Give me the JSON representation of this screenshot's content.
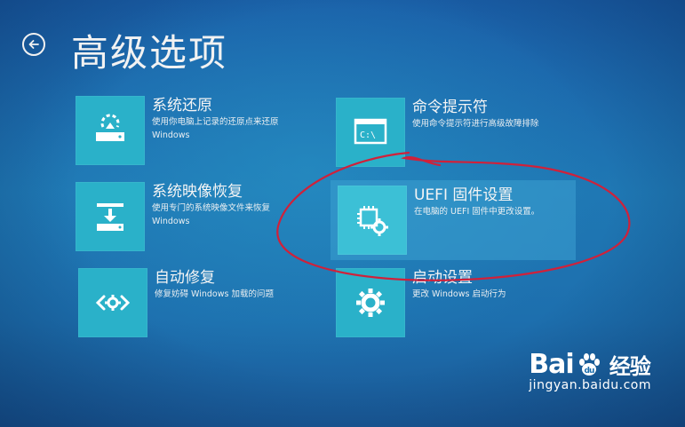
{
  "header": {
    "title": "高级选项",
    "back_icon": "back-arrow-icon"
  },
  "tiles": [
    {
      "id": "system-restore",
      "title": "系统还原",
      "desc_line1": "使用你电脑上记录的还原点来还原",
      "desc_line2": "Windows",
      "icon": "restore-icon"
    },
    {
      "id": "system-image-recovery",
      "title": "系统映像恢复",
      "desc_line1": "使用专门的系统映像文件来恢复",
      "desc_line2": "Windows",
      "icon": "image-recovery-icon"
    },
    {
      "id": "startup-repair",
      "title": "自动修复",
      "desc_line1": "修复妨碍 Windows 加载的问题",
      "desc_line2": "",
      "icon": "startup-repair-icon"
    },
    {
      "id": "command-prompt",
      "title": "命令提示符",
      "desc_line1": "使用命令提示符进行高级故障排除",
      "desc_line2": "",
      "icon": "command-prompt-icon",
      "icon_text": "C:\\"
    },
    {
      "id": "uefi-settings",
      "title": "UEFI 固件设置",
      "desc_line1": "在电脑的 UEFI 固件中更改设置。",
      "desc_line2": "",
      "icon": "uefi-chip-gear-icon"
    },
    {
      "id": "startup-settings",
      "title": "启动设置",
      "desc_line1": "更改 Windows 启动行为",
      "desc_line2": "",
      "icon": "gear-icon"
    }
  ],
  "watermark": {
    "logo_left": "Bai",
    "logo_right": "经验",
    "url": "jingyan.baidu.com"
  },
  "colors": {
    "tile_bg": "#2ab1c9",
    "annotation": "#d0213a"
  }
}
